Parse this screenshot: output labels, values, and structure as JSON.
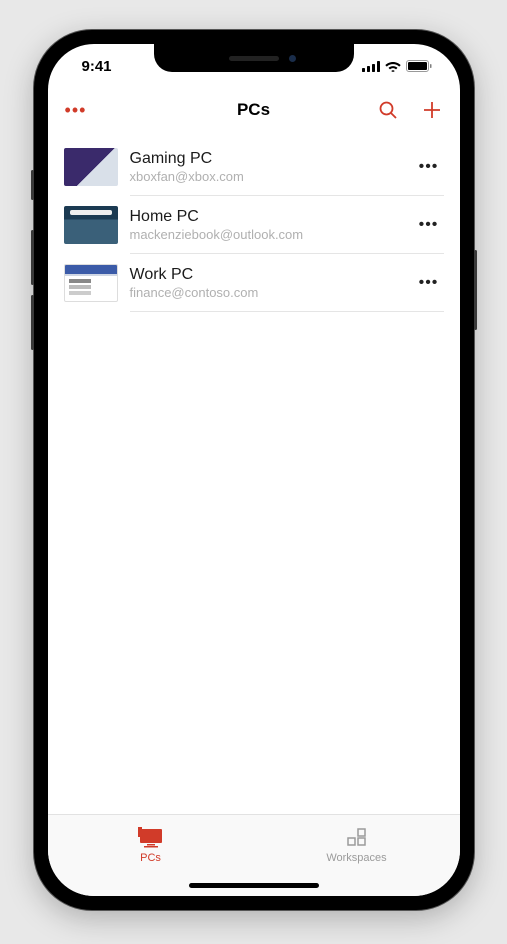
{
  "statusbar": {
    "time": "9:41"
  },
  "header": {
    "title": "PCs"
  },
  "pcs": [
    {
      "name": "Gaming PC",
      "account": "xboxfan@xbox.com"
    },
    {
      "name": "Home PC",
      "account": "mackenziebook@outlook.com"
    },
    {
      "name": "Work PC",
      "account": "finance@contoso.com"
    }
  ],
  "tabs": {
    "pcs": "PCs",
    "workspaces": "Workspaces"
  }
}
